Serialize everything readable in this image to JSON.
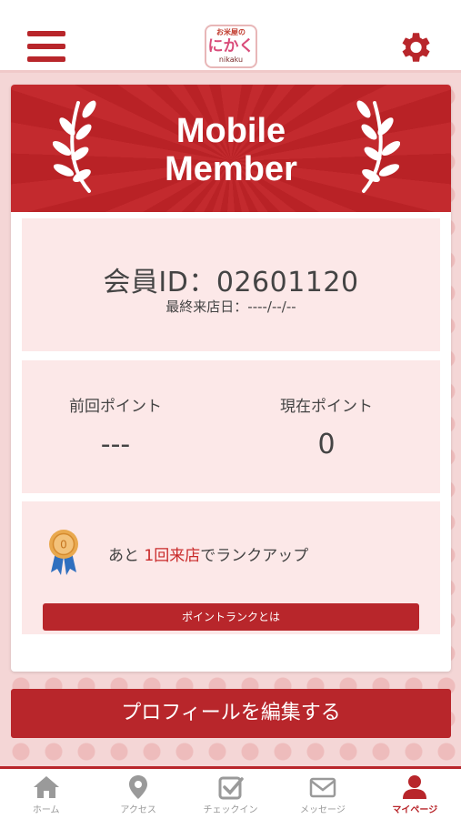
{
  "header": {
    "menu_icon": "hamburger-icon",
    "settings_icon": "gear-icon",
    "logo": {
      "line1": "お米屋の",
      "line2": "にかく",
      "line3": "nikaku"
    }
  },
  "banner": {
    "title_line1": "Mobile",
    "title_line2": "Member"
  },
  "member": {
    "id_text": "会員ID：02601120",
    "last_visit": "最終来店日：----/--/--"
  },
  "points": {
    "previous_label": "前回ポイント",
    "previous_value": "---",
    "current_label": "現在ポイント",
    "current_value": "0"
  },
  "rank": {
    "text_before": "あと ",
    "highlight": "1回来店",
    "text_after": "でランクアップ",
    "button_label": "ポイントランクとは"
  },
  "profile_button": "プロフィールを編集する",
  "tabs": [
    {
      "label": "ホーム",
      "icon": "home-icon",
      "active": false
    },
    {
      "label": "アクセス",
      "icon": "map-pin-icon",
      "active": false
    },
    {
      "label": "チェックイン",
      "icon": "checkin-icon",
      "active": false
    },
    {
      "label": "メッセージ",
      "icon": "envelope-icon",
      "active": false
    },
    {
      "label": "マイページ",
      "icon": "user-icon",
      "active": true
    }
  ],
  "colors": {
    "primary": "#b8262b",
    "panel": "#fce8e8",
    "background": "#f4d6d6"
  }
}
